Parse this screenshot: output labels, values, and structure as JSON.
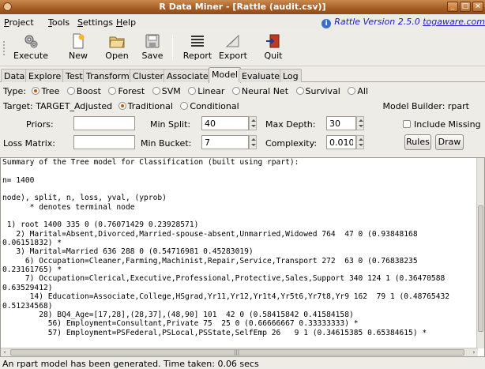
{
  "window": {
    "title": "R Data Miner - [Rattle (audit.csv)]",
    "buttons": [
      "_",
      "□",
      "×"
    ]
  },
  "menu": {
    "items": [
      "Project",
      "Tools",
      "Settings",
      "Help"
    ],
    "version_text": "Rattle Version 2.5.0 ",
    "version_link": "togaware.com"
  },
  "toolbar": {
    "execute": "Execute",
    "new": "New",
    "open": "Open",
    "save": "Save",
    "report": "Report",
    "export": "Export",
    "quit": "Quit"
  },
  "tabs": [
    "Data",
    "Explore",
    "Test",
    "Transform",
    "Cluster",
    "Associate",
    "Model",
    "Evaluate",
    "Log"
  ],
  "active_tab": "Model",
  "model_types": {
    "label": "Type:",
    "options": [
      "Tree",
      "Boost",
      "Forest",
      "SVM",
      "Linear",
      "Neural Net",
      "Survival",
      "All"
    ],
    "selected": "Tree"
  },
  "target": {
    "label": "Target: TARGET_Adjusted",
    "options": [
      "Traditional",
      "Conditional"
    ],
    "selected": "Traditional",
    "builder": "Model Builder:  rpart"
  },
  "params": {
    "priors_label": "Priors:",
    "priors_value": "",
    "min_split_label": "Min Split:",
    "min_split_value": "40",
    "max_depth_label": "Max Depth:",
    "max_depth_value": "30",
    "include_missing": "Include Missing",
    "loss_matrix_label": "Loss Matrix:",
    "loss_matrix_value": "",
    "min_bucket_label": "Min Bucket:",
    "min_bucket_value": "7",
    "complexity_label": "Complexity:",
    "complexity_value": "0.0100",
    "rules_button": "Rules",
    "draw_button": "Draw"
  },
  "output_text": "Summary of the Tree model for Classification (built using rpart):\n\nn= 1400\n\nnode), split, n, loss, yval, (yprob)\n      * denotes terminal node\n\n 1) root 1400 335 0 (0.76071429 0.23928571)\n   2) Marital=Absent,Divorced,Married-spouse-absent,Unmarried,Widowed 764  47 0 (0.93848168\n0.06151832) *\n   3) Marital=Married 636 288 0 (0.54716981 0.45283019)\n     6) Occupation=Cleaner,Farming,Machinist,Repair,Service,Transport 272  63 0 (0.76838235\n0.23161765) *\n     7) Occupation=Clerical,Executive,Professional,Protective,Sales,Support 340 124 1 (0.36470588\n0.63529412)\n      14) Education=Associate,College,HSgrad,Yr11,Yr12,Yr1t4,Yr5t6,Yr7t8,Yr9 162  79 1 (0.48765432\n0.51234568)\n        28) BQ4_Age=[17,28],(28,37],(48,90] 101  42 0 (0.58415842 0.41584158)\n          56) Employment=Consultant,Private 75  25 0 (0.66666667 0.33333333) *\n          57) Employment=PSFederal,PSLocal,PSState,SelfEmp 26   9 1 (0.34615385 0.65384615) *",
  "status": "An rpart model has been generated. Time taken: 0.06 secs"
}
